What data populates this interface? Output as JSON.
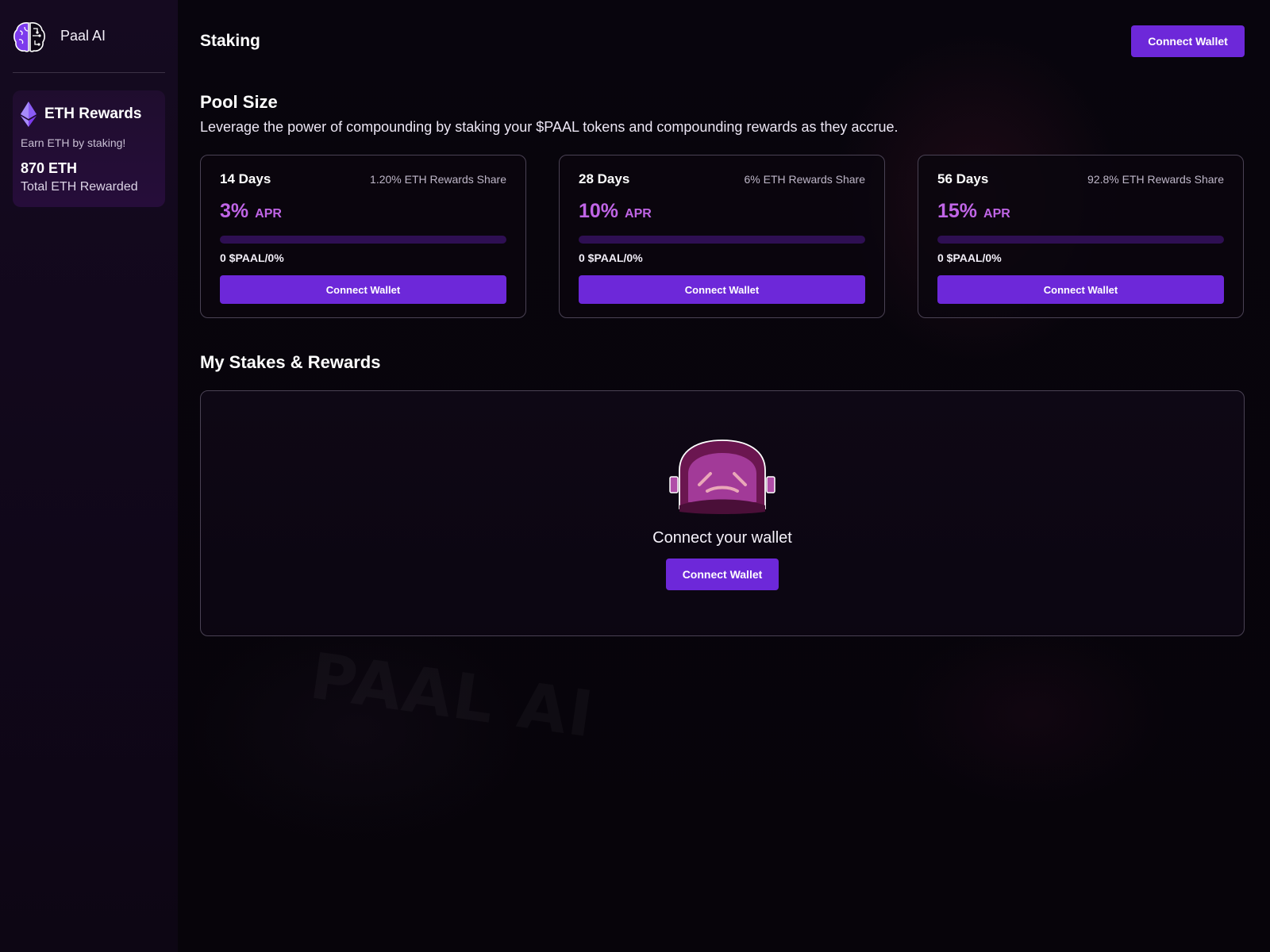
{
  "brand": {
    "name": "Paal AI",
    "logo_icon": "brain-icon"
  },
  "sidebar": {
    "rewards": {
      "icon": "ethereum-icon",
      "title": "ETH Rewards",
      "subtitle": "Earn ETH by staking!",
      "amount": "870 ETH",
      "amount_label": "Total ETH Rewarded"
    }
  },
  "header": {
    "title": "Staking",
    "connect_label": "Connect Wallet"
  },
  "pool": {
    "title": "Pool Size",
    "description": "Leverage the power of compounding by staking your $PAAL tokens and compounding rewards as they accrue.",
    "cards": [
      {
        "days": "14 Days",
        "share": "1.20% ETH Rewards Share",
        "apr": "3%",
        "apr_label": "APR",
        "progress": 0,
        "staked": "0 $PAAL/0%",
        "button": "Connect Wallet"
      },
      {
        "days": "28 Days",
        "share": "6% ETH Rewards Share",
        "apr": "10%",
        "apr_label": "APR",
        "progress": 0,
        "staked": "0 $PAAL/0%",
        "button": "Connect Wallet"
      },
      {
        "days": "56 Days",
        "share": "92.8% ETH Rewards Share",
        "apr": "15%",
        "apr_label": "APR",
        "progress": 0,
        "staked": "0 $PAAL/0%",
        "button": "Connect Wallet"
      }
    ]
  },
  "stakes": {
    "title": "My Stakes & Rewards",
    "empty_icon": "sad-helmet-icon",
    "empty_text": "Connect your wallet",
    "button": "Connect Wallet"
  },
  "colors": {
    "accent": "#6d28d9",
    "apr": "#c065e6",
    "progress_track": "#2e0f52"
  }
}
